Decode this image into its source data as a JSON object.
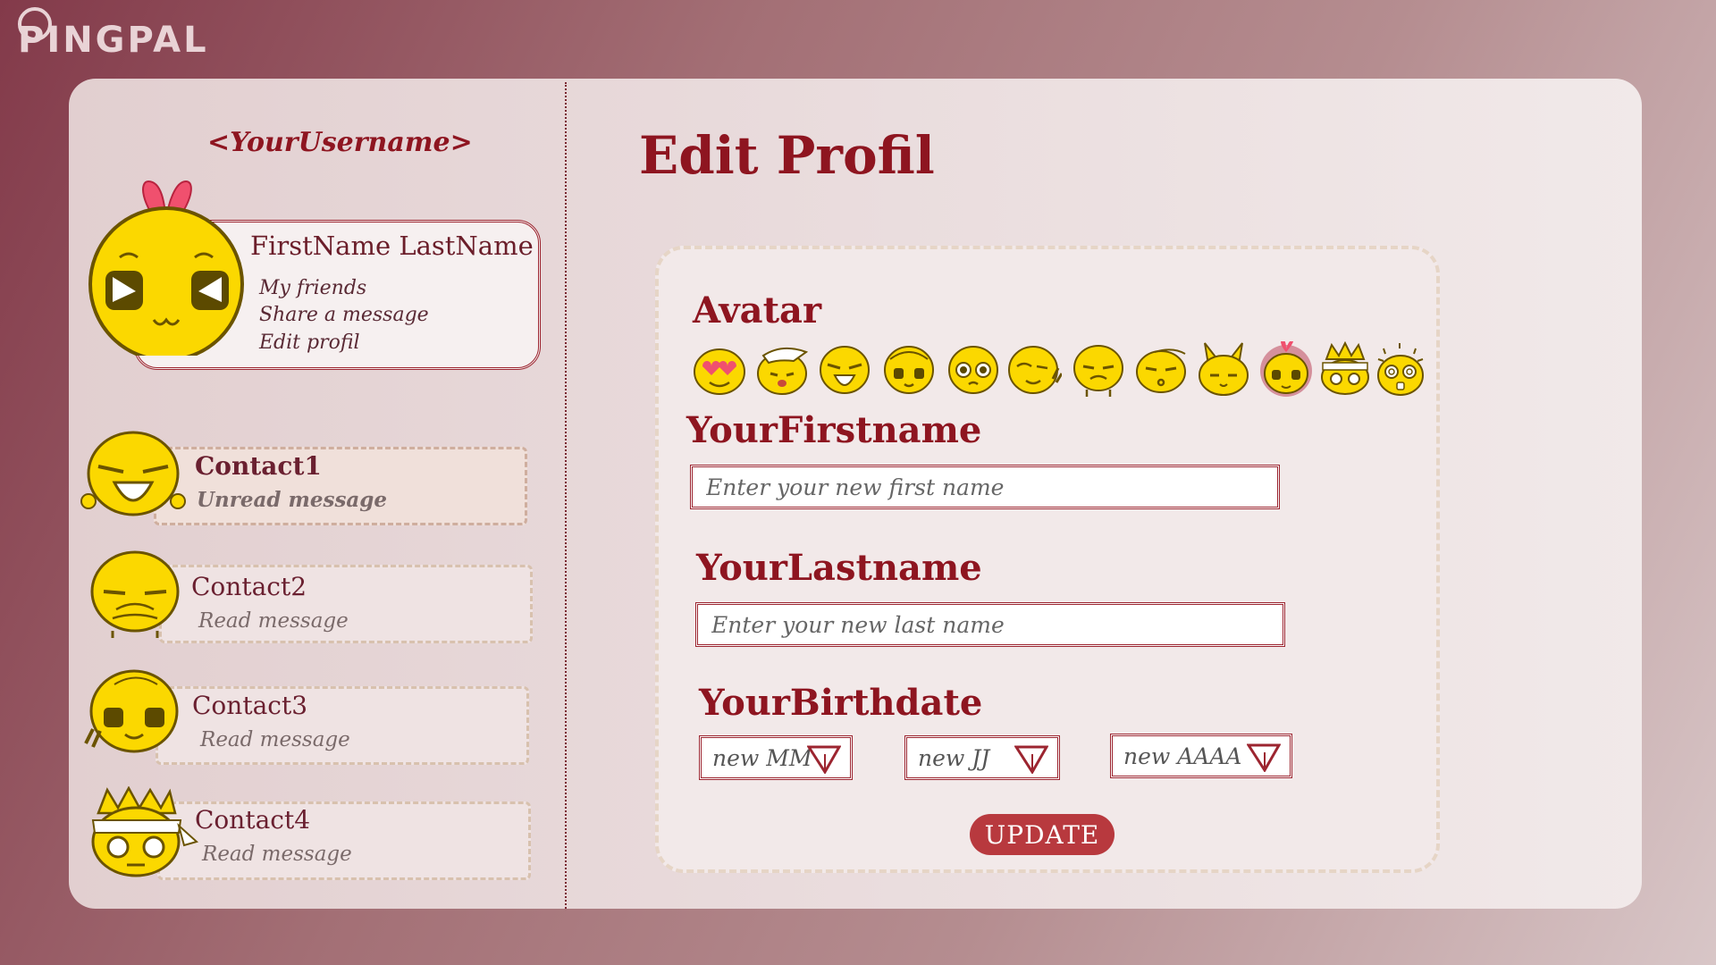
{
  "app": {
    "logo": "PINGPAL"
  },
  "sidebar": {
    "username": "<YourUsername>",
    "profile": {
      "full_name": "FirstName LastName",
      "links": [
        "My friends",
        "Share a message",
        "Edit profil"
      ]
    },
    "contacts": [
      {
        "name": "Contact1",
        "status": "Unread message",
        "unread": true
      },
      {
        "name": "Contact2",
        "status": "Read message",
        "unread": false
      },
      {
        "name": "Contact3",
        "status": "Read message",
        "unread": false
      },
      {
        "name": "Contact4",
        "status": "Read message",
        "unread": false
      }
    ]
  },
  "main": {
    "title": "Edit Profil",
    "avatar": {
      "label": "Avatar",
      "options": [
        "love",
        "cap",
        "laugh",
        "blink",
        "shy",
        "wink",
        "sad",
        "kiss",
        "bunny",
        "bow",
        "crown",
        "dizzy"
      ],
      "selected": "bow"
    },
    "firstname": {
      "label": "YourFirstname",
      "placeholder": "Enter your new first name"
    },
    "lastname": {
      "label": "YourLastname",
      "placeholder": "Enter your new last name"
    },
    "birthdate": {
      "label": "YourBirthdate",
      "month": "new MM",
      "day": "new JJ",
      "year": "new AAAA"
    },
    "update_label": "UPDATE"
  },
  "colors": {
    "accent": "#8e1520",
    "button": "#b8393e",
    "emoji_yellow": "#fbd800",
    "emoji_outline": "#6b5400",
    "bow_pink": "#f0506e"
  }
}
